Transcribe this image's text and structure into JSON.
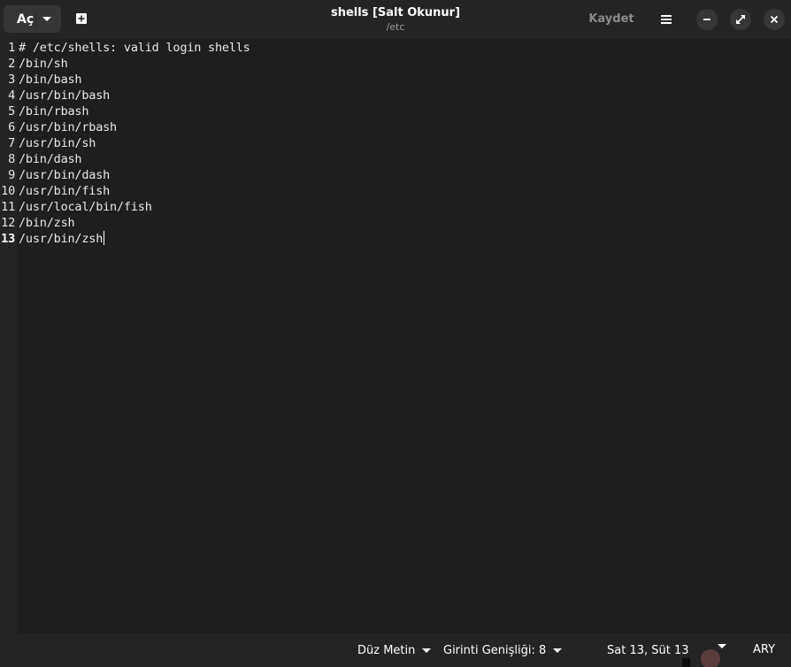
{
  "header": {
    "open_label": "Aç",
    "title": "shells [Salt Okunur]",
    "subtitle": "/etc",
    "save_label": "Kaydet"
  },
  "editor": {
    "lines": [
      {
        "n": "1",
        "text": "# /etc/shells: valid login shells"
      },
      {
        "n": "2",
        "text": "/bin/sh"
      },
      {
        "n": "3",
        "text": "/bin/bash"
      },
      {
        "n": "4",
        "text": "/usr/bin/bash"
      },
      {
        "n": "5",
        "text": "/bin/rbash"
      },
      {
        "n": "6",
        "text": "/usr/bin/rbash"
      },
      {
        "n": "7",
        "text": "/usr/bin/sh"
      },
      {
        "n": "8",
        "text": "/bin/dash"
      },
      {
        "n": "9",
        "text": "/usr/bin/dash"
      },
      {
        "n": "10",
        "text": "/usr/bin/fish"
      },
      {
        "n": "11",
        "text": "/usr/local/bin/fish"
      },
      {
        "n": "12",
        "text": "/bin/zsh"
      },
      {
        "n": "13",
        "text": "/usr/bin/zsh"
      }
    ],
    "current_line": "13"
  },
  "statusbar": {
    "language": "Düz Metin",
    "indent": "Girinti Genişliği: 8",
    "position": "Sat 13, Süt 13",
    "mode": "ARY"
  },
  "icons": {
    "open_dropdown": "chevron-down-icon",
    "new_tab": "new-tab-icon",
    "menu": "hamburger-menu-icon",
    "minimize": "minimize-icon",
    "maximize": "maximize-icon",
    "close": "close-icon"
  },
  "colors": {
    "editor_bg": "#1e1e1e",
    "chrome_bg": "#242424",
    "button_bg": "#363636",
    "text": "#ffffff",
    "muted_text": "#9a9a9a"
  }
}
